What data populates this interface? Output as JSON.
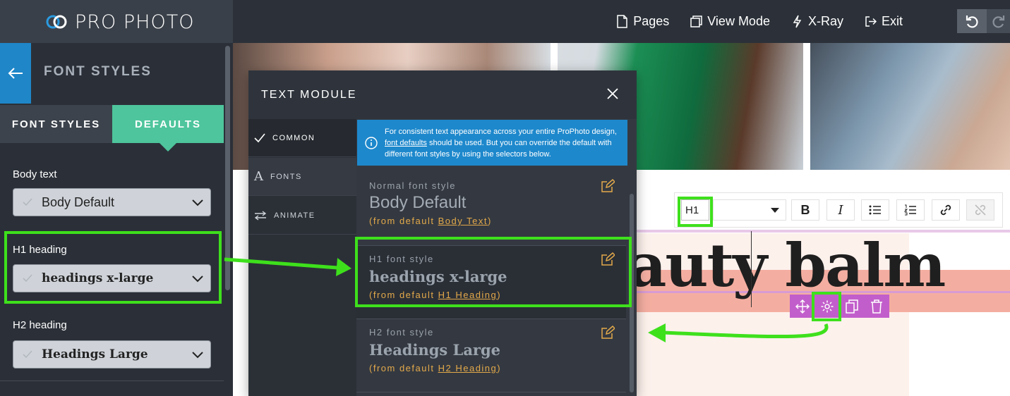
{
  "app": {
    "logo_text": "PRO PHOTO"
  },
  "topnav": {
    "pages": "Pages",
    "view_mode": "View Mode",
    "xray": "X-Ray",
    "exit": "Exit"
  },
  "sidebar": {
    "title": "FONT STYLES",
    "tabs": {
      "font_styles": "FONT STYLES",
      "defaults": "DEFAULTS"
    },
    "fields": [
      {
        "label": "Body text",
        "value": "Body Default"
      },
      {
        "label": "H1 heading",
        "value": "headings x-large"
      },
      {
        "label": "H2 heading",
        "value": "Headings Large"
      }
    ]
  },
  "panel": {
    "title": "TEXT MODULE",
    "nav": [
      {
        "label": "COMMON"
      },
      {
        "label": "FONTS"
      },
      {
        "label": "ANIMATE"
      }
    ],
    "info": {
      "part1": "For consistent text appearance across your entire ProPhoto design,",
      "link": "font defaults",
      "part2": "should be used. But you can override the default with different font styles by using the selectors below."
    },
    "font_styles": [
      {
        "label": "Normal font style",
        "name": "Body Default",
        "from_prefix": "(from default",
        "from_link": "Body Text",
        "from_suffix": ")"
      },
      {
        "label": "H1 font style",
        "name": "headings x-large",
        "from_prefix": "(from default",
        "from_link": "H1 Heading",
        "from_suffix": ")"
      },
      {
        "label": "H2 font style",
        "name": "Headings Large",
        "from_prefix": "(from default",
        "from_link": "H2 Heading",
        "from_suffix": ")"
      }
    ]
  },
  "canvas": {
    "toolbar": {
      "heading_level": "H1",
      "bold": "B",
      "italic": "I"
    },
    "heading_text": "auty balm"
  },
  "colors": {
    "accent_green": "#4ec59c",
    "info_blue": "#1e88cc",
    "annotation_green": "#3ee01c",
    "edit_purple": "#c25ecb",
    "link_gold": "#e3a94a"
  }
}
